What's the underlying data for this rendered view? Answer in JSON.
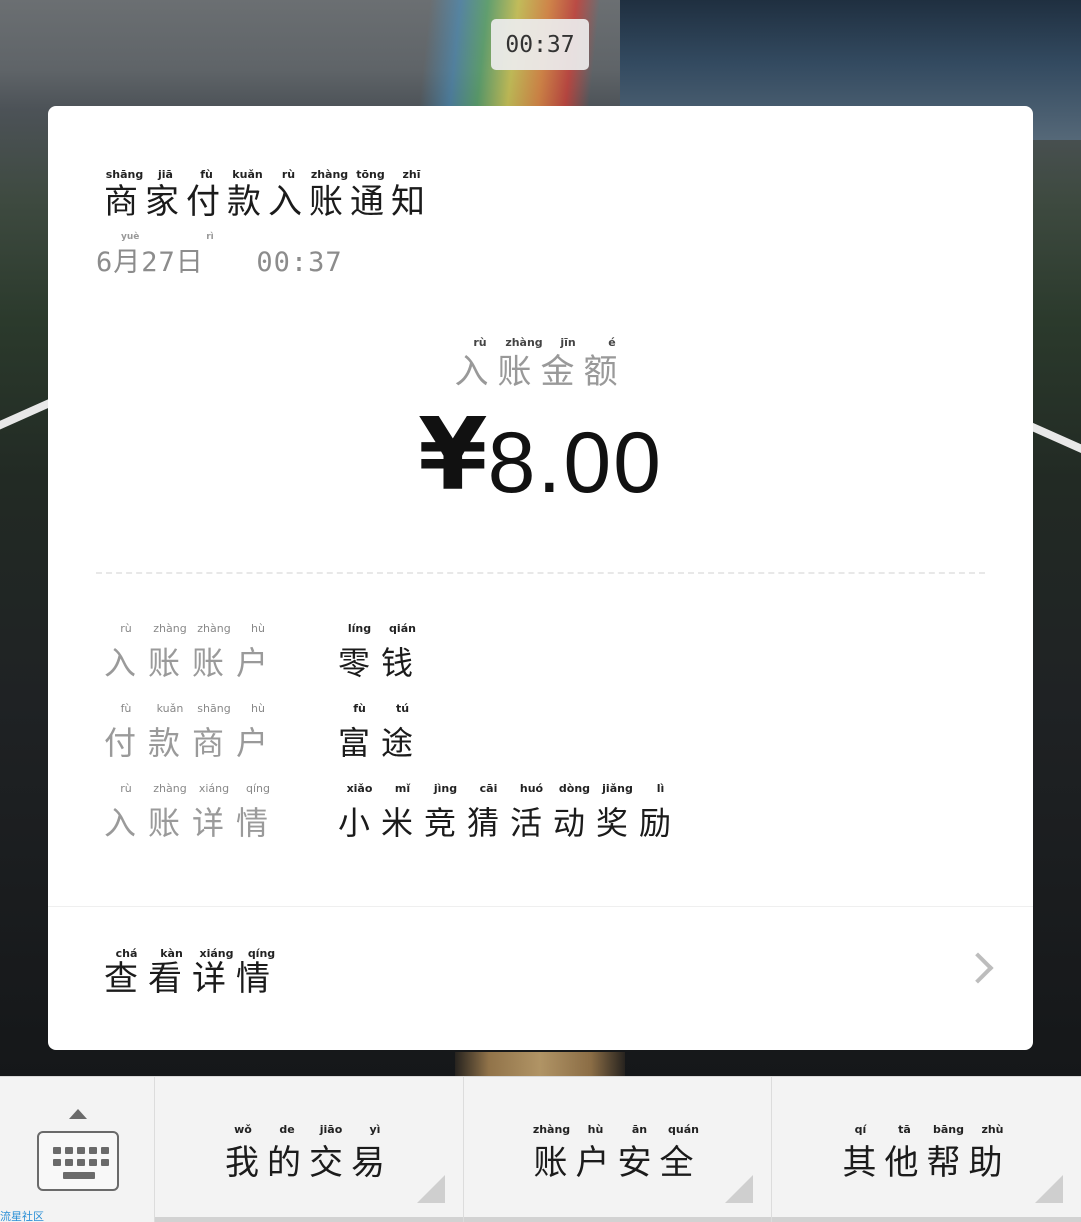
{
  "status": {
    "time": "00:37"
  },
  "notice": {
    "title": "商家付款入账通知",
    "title_pinyin": [
      "shāng",
      "jiā",
      "fù",
      "kuǎn",
      "rù",
      "zhàng",
      "tōng",
      "zhī"
    ],
    "date": "6月27日",
    "date_pinyin_yue": "yuè",
    "date_pinyin_ri": "rì",
    "time": "00:37",
    "amount_label": "入账金额",
    "amount_label_pinyin": [
      "rù",
      "zhàng",
      "jīn",
      "é"
    ],
    "currency_symbol": "¥",
    "amount": "8.00",
    "details": [
      {
        "label": "入账账户",
        "label_pinyin": [
          "rù",
          "zhàng",
          "zhàng",
          "hù"
        ],
        "value": "零钱",
        "value_pinyin": [
          "líng",
          "qián"
        ]
      },
      {
        "label": "付款商户",
        "label_pinyin": [
          "fù",
          "kuǎn",
          "shāng",
          "hù"
        ],
        "value": "富途",
        "value_pinyin": [
          "fù",
          "tú"
        ]
      },
      {
        "label": "入账详情",
        "label_pinyin": [
          "rù",
          "zhàng",
          "xiáng",
          "qíng"
        ],
        "value": "小米竞猜活动奖励",
        "value_pinyin": [
          "xiǎo",
          "mǐ",
          "jìng",
          "cāi",
          "huó",
          "dòng",
          "jiǎng",
          "lì"
        ]
      }
    ],
    "view_details": "查看详情",
    "view_details_pinyin": [
      "chá",
      "kàn",
      "xiáng",
      "qíng"
    ]
  },
  "bottom_menu": [
    {
      "label": "我的交易",
      "pinyin": [
        "wǒ",
        "de",
        "jiāo",
        "yì"
      ]
    },
    {
      "label": "账户安全",
      "pinyin": [
        "zhàng",
        "hù",
        "ān",
        "quán"
      ]
    },
    {
      "label": "其他帮助",
      "pinyin": [
        "qí",
        "tā",
        "bāng",
        "zhù"
      ]
    }
  ],
  "watermark": "流星社区",
  "icons": {
    "keyboard": "keyboard-icon",
    "caret_up": "caret-up-icon",
    "chevron_right": "chevron-right-icon"
  },
  "colors": {
    "card": "#ffffff",
    "label_gray": "#9a9a9a",
    "text_dark": "#1b1b1b",
    "bar_bg": "#f3f3f3"
  }
}
